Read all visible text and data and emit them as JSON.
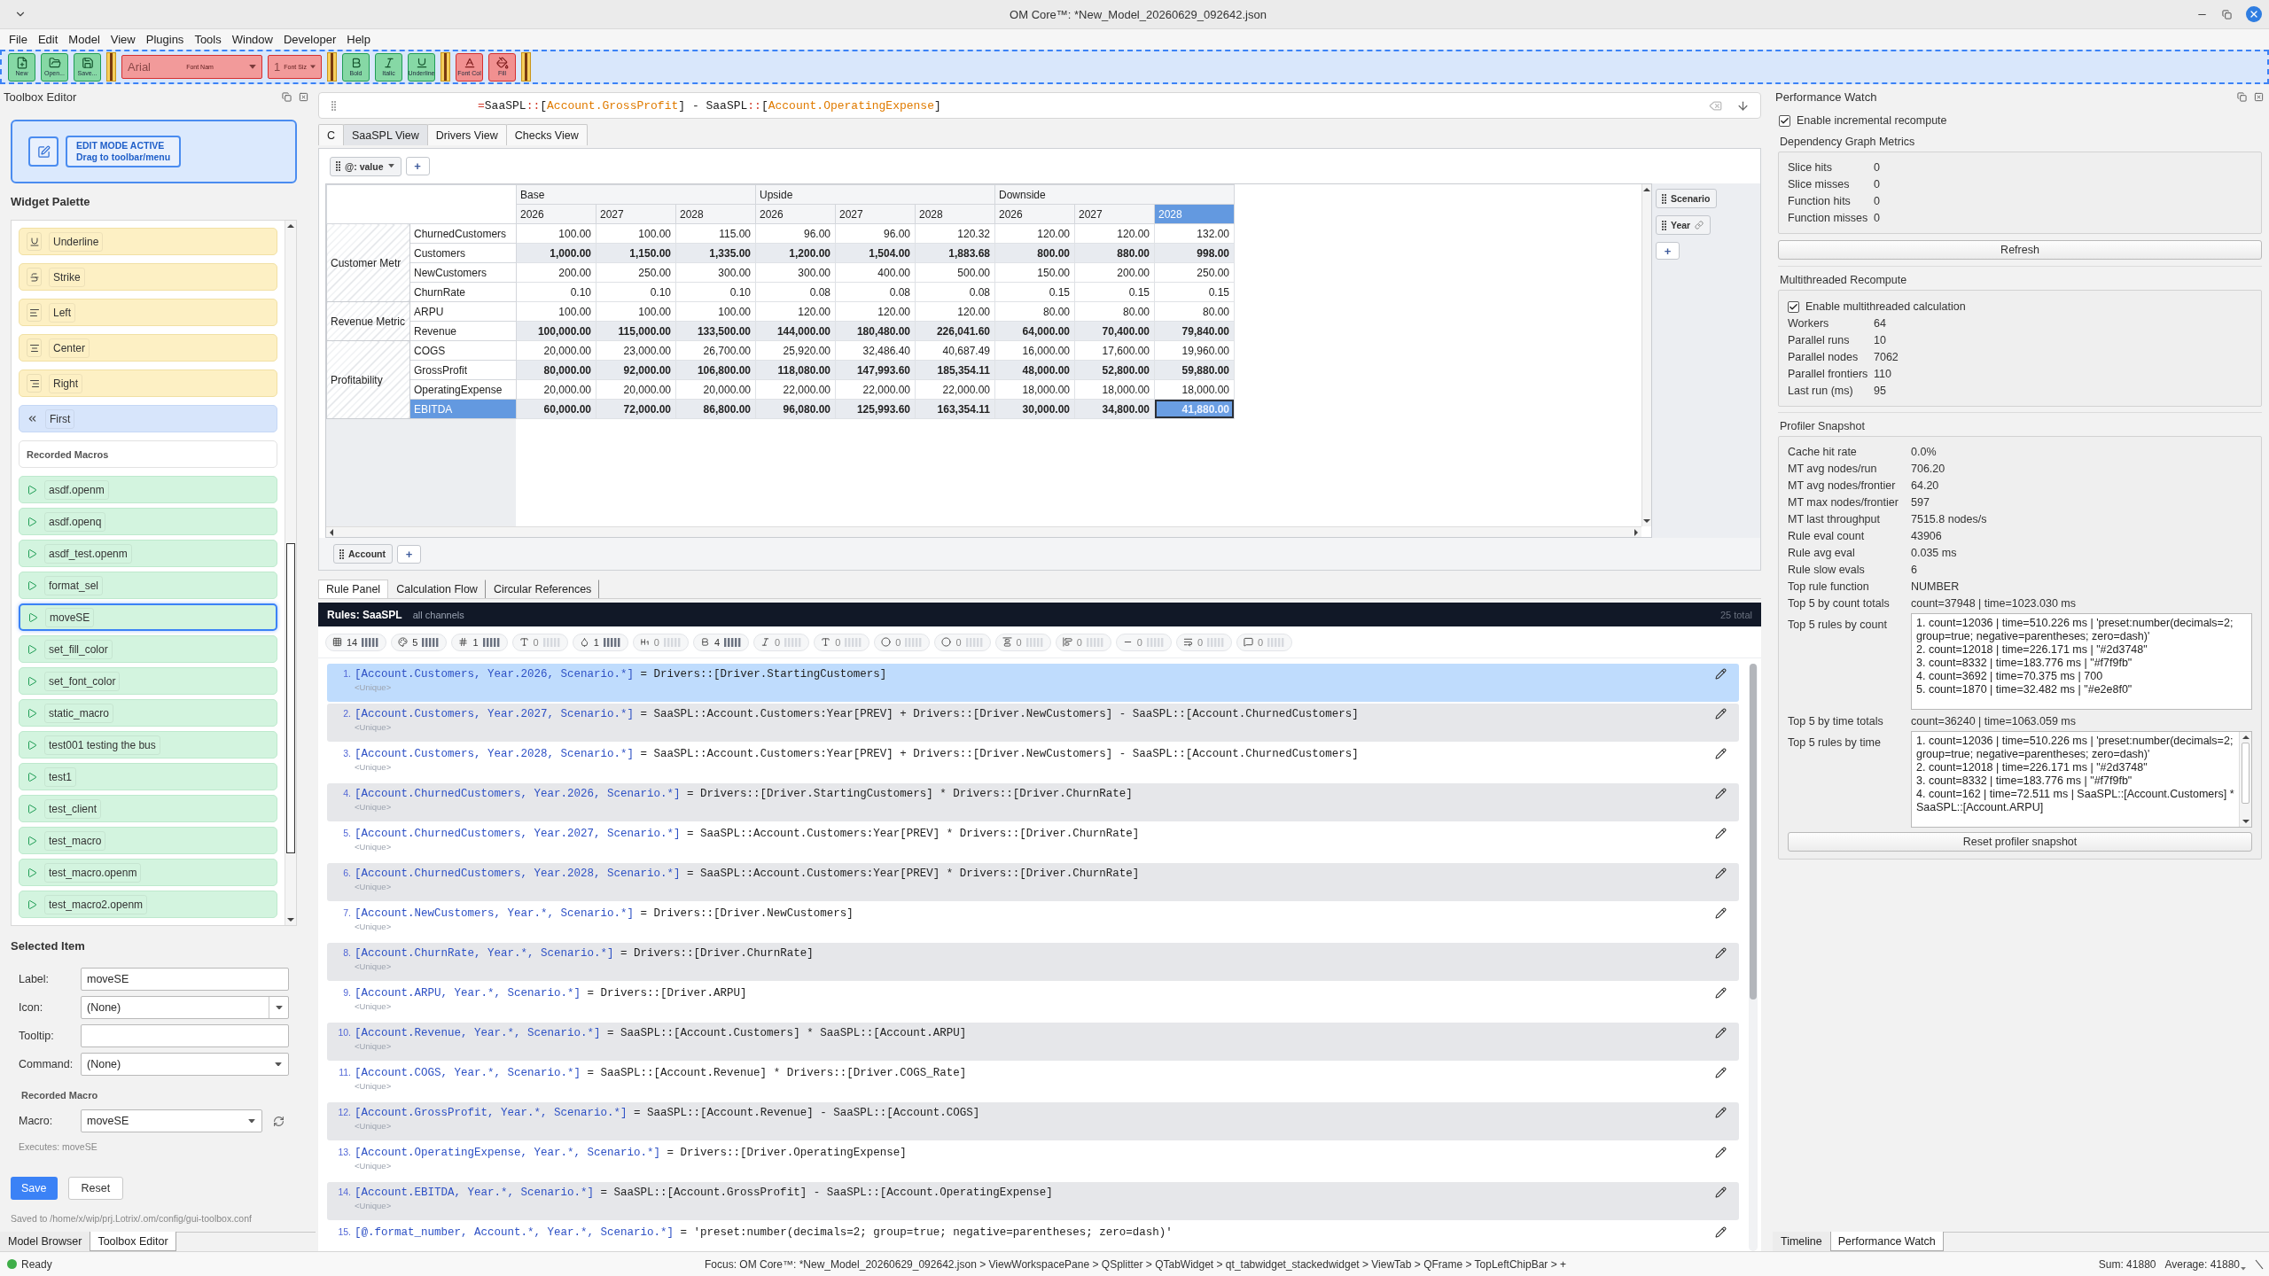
{
  "window": {
    "title": "OM Core™: *New_Model_20260629_092642.json"
  },
  "menu": [
    "File",
    "Edit",
    "Model",
    "View",
    "Plugins",
    "Tools",
    "Window",
    "Developer",
    "Help"
  ],
  "toolbar": [
    {
      "kind": "button",
      "label": "New"
    },
    {
      "kind": "button",
      "label": "Open..."
    },
    {
      "kind": "button",
      "label": "Save..."
    },
    {
      "kind": "separator"
    },
    {
      "kind": "combo",
      "value": "Arial",
      "label": "Font Nam"
    },
    {
      "kind": "combo",
      "value": "1",
      "label": "Font Siz"
    },
    {
      "kind": "separator"
    },
    {
      "kind": "button",
      "label": "Bold"
    },
    {
      "kind": "button",
      "label": "Italic"
    },
    {
      "kind": "button",
      "label": "Underline"
    },
    {
      "kind": "separator"
    },
    {
      "kind": "color",
      "label": "Font Col"
    },
    {
      "kind": "color",
      "label": "Fill"
    },
    {
      "kind": "separator"
    }
  ],
  "toolbox_editor": {
    "title": "Toolbox Editor",
    "edit_mode": {
      "title": "EDIT MODE ACTIVE",
      "hint": "Drag to toolbar/menu"
    },
    "palette_title": "Widget Palette",
    "palette": [
      {
        "kind": "format",
        "label": "Underline",
        "selected": false
      },
      {
        "kind": "format",
        "label": "Strike",
        "selected": false
      },
      {
        "kind": "format",
        "label": "Left",
        "selected": false
      },
      {
        "kind": "format",
        "label": "Center",
        "selected": false
      },
      {
        "kind": "format",
        "label": "Right",
        "selected": false
      },
      {
        "kind": "nav",
        "label": "First",
        "selected": false
      },
      {
        "kind": "header",
        "label": "Recorded Macros"
      },
      {
        "kind": "macro",
        "label": "asdf.openm",
        "selected": false
      },
      {
        "kind": "macro",
        "label": "asdf.openq",
        "selected": false
      },
      {
        "kind": "macro",
        "label": "asdf_test.openm",
        "selected": false
      },
      {
        "kind": "macro",
        "label": "format_sel",
        "selected": false
      },
      {
        "kind": "macro",
        "label": "moveSE",
        "selected": true
      },
      {
        "kind": "macro",
        "label": "set_fill_color",
        "selected": false
      },
      {
        "kind": "macro",
        "label": "set_font_color",
        "selected": false
      },
      {
        "kind": "macro",
        "label": "static_macro",
        "selected": false
      },
      {
        "kind": "macro",
        "label": "test001 testing the bus",
        "selected": false
      },
      {
        "kind": "macro",
        "label": "test1",
        "selected": false
      },
      {
        "kind": "macro",
        "label": "test_client",
        "selected": false
      },
      {
        "kind": "macro",
        "label": "test_macro",
        "selected": false
      },
      {
        "kind": "macro",
        "label": "test_macro.openm",
        "selected": false
      },
      {
        "kind": "macro",
        "label": "test_macro2.openm",
        "selected": false
      }
    ],
    "selected_item": {
      "title": "Selected Item",
      "fields": [
        {
          "kind": "text",
          "label": "Label:",
          "value": "moveSE"
        },
        {
          "kind": "editable-combo",
          "label": "Icon:",
          "value": "(None)"
        },
        {
          "kind": "text",
          "label": "Tooltip:"
        },
        {
          "kind": "combo",
          "label": "Command:",
          "value": "(None)"
        }
      ],
      "macro_title": "Recorded Macro",
      "macro_label": "Macro:",
      "macro_value": "moveSE",
      "macro_note": "Executes: moveSE",
      "save": "Save",
      "reset": "Reset",
      "saved_path": "Saved to /home/x/wip/prj.Lotrix/.om/config/gui-toolbox.conf"
    },
    "tabs": [
      {
        "label": "Model Browser",
        "selected": false
      },
      {
        "label": "Toolbox Editor",
        "selected": true
      }
    ]
  },
  "formula_bar": {
    "tokens": [
      {
        "kind": "op",
        "text": "="
      },
      {
        "kind": "plain",
        "text": "SaaSPL"
      },
      {
        "kind": "op",
        "text": "::"
      },
      {
        "kind": "plain",
        "text": "["
      },
      {
        "kind": "member",
        "text": "Account.GrossProfit"
      },
      {
        "kind": "plain",
        "text": "] - SaaSPL"
      },
      {
        "kind": "op",
        "text": "::"
      },
      {
        "kind": "plain",
        "text": "["
      },
      {
        "kind": "member",
        "text": "Account.OperatingExpense"
      },
      {
        "kind": "plain",
        "text": "]"
      }
    ]
  },
  "view_tabs": [
    {
      "label": "C",
      "selected": false
    },
    {
      "label": "SaaSPL View",
      "selected": true
    },
    {
      "label": "Drivers View",
      "selected": false
    },
    {
      "label": "Checks View",
      "selected": false
    }
  ],
  "pivot": {
    "top_chips": [
      {
        "label": "@: value",
        "dropdown": true
      }
    ],
    "top_add": "+",
    "column_chips": [
      {
        "label": "Scenario",
        "linked": false
      },
      {
        "label": "Year",
        "linked": true
      }
    ],
    "column_add": "+",
    "row_chips": [
      {
        "label": "Account"
      }
    ],
    "row_add": "+",
    "column_groups": [
      {
        "label": "Base",
        "columns": [
          {
            "label": "2026",
            "selected": false
          },
          {
            "label": "2027",
            "selected": false
          },
          {
            "label": "2028",
            "selected": false
          }
        ]
      },
      {
        "label": "Upside",
        "columns": [
          {
            "label": "2026",
            "selected": false
          },
          {
            "label": "2027",
            "selected": false
          },
          {
            "label": "2028",
            "selected": false
          }
        ]
      },
      {
        "label": "Downside",
        "columns": [
          {
            "label": "2026",
            "selected": false
          },
          {
            "label": "2027",
            "selected": false
          },
          {
            "label": "2028",
            "selected": true
          }
        ]
      }
    ],
    "row_groups": [
      {
        "label": "Customer Metr",
        "rows": [
          {
            "label": "ChurnedCustomers",
            "bold": false,
            "selected": false,
            "cells": [
              "100.00",
              "100.00",
              "115.00",
              "96.00",
              "96.00",
              "120.32",
              "120.00",
              "120.00",
              "132.00"
            ]
          },
          {
            "label": "Customers",
            "bold": true,
            "selected": false,
            "cells": [
              "1,000.00",
              "1,150.00",
              "1,335.00",
              "1,200.00",
              "1,504.00",
              "1,883.68",
              "800.00",
              "880.00",
              "998.00"
            ]
          },
          {
            "label": "NewCustomers",
            "bold": false,
            "selected": false,
            "cells": [
              "200.00",
              "250.00",
              "300.00",
              "300.00",
              "400.00",
              "500.00",
              "150.00",
              "200.00",
              "250.00"
            ]
          },
          {
            "label": "ChurnRate",
            "bold": false,
            "selected": false,
            "cells": [
              "0.10",
              "0.10",
              "0.10",
              "0.08",
              "0.08",
              "0.08",
              "0.15",
              "0.15",
              "0.15"
            ]
          }
        ]
      },
      {
        "label": "Revenue Metric",
        "rows": [
          {
            "label": "ARPU",
            "bold": false,
            "selected": false,
            "cells": [
              "100.00",
              "100.00",
              "100.00",
              "120.00",
              "120.00",
              "120.00",
              "80.00",
              "80.00",
              "80.00"
            ]
          },
          {
            "label": "Revenue",
            "bold": true,
            "selected": false,
            "cells": [
              "100,000.00",
              "115,000.00",
              "133,500.00",
              "144,000.00",
              "180,480.00",
              "226,041.60",
              "64,000.00",
              "70,400.00",
              "79,840.00"
            ]
          }
        ]
      },
      {
        "label": "Profitability",
        "rows": [
          {
            "label": "COGS",
            "bold": false,
            "selected": false,
            "cells": [
              "20,000.00",
              "23,000.00",
              "26,700.00",
              "25,920.00",
              "32,486.40",
              "40,687.49",
              "16,000.00",
              "17,600.00",
              "19,960.00"
            ]
          },
          {
            "label": "GrossProfit",
            "bold": true,
            "selected": false,
            "cells": [
              "80,000.00",
              "92,000.00",
              "106,800.00",
              "118,080.00",
              "147,993.60",
              "185,354.11",
              "48,000.00",
              "52,800.00",
              "59,880.00"
            ]
          },
          {
            "label": "OperatingExpense",
            "bold": false,
            "selected": false,
            "cells": [
              "20,000.00",
              "20,000.00",
              "20,000.00",
              "22,000.00",
              "22,000.00",
              "22,000.00",
              "18,000.00",
              "18,000.00",
              "18,000.00"
            ]
          },
          {
            "label": "EBITDA",
            "bold": true,
            "selected": true,
            "cells": [
              "60,000.00",
              "72,000.00",
              "86,800.00",
              "96,080.00",
              "125,993.60",
              "163,354.11",
              "30,000.00",
              "34,800.00",
              "41,880.00"
            ]
          }
        ]
      }
    ]
  },
  "rule_tabs": [
    {
      "label": "Rule Panel",
      "selected": true
    },
    {
      "label": "Calculation Flow",
      "selected": false
    },
    {
      "label": "Circular References",
      "selected": false
    }
  ],
  "rules": {
    "title": "Rules: SaaSPL",
    "scope": "all channels",
    "total": "25 total",
    "stats": [
      {
        "count": "14",
        "active": true
      },
      {
        "count": "5",
        "active": true
      },
      {
        "count": "1",
        "active": true
      },
      {
        "count": "0",
        "active": false
      },
      {
        "count": "1",
        "active": true
      },
      {
        "count": "0",
        "active": false
      },
      {
        "count": "4",
        "active": true
      },
      {
        "count": "0",
        "active": false
      },
      {
        "count": "0",
        "active": false
      },
      {
        "count": "0",
        "active": false
      },
      {
        "count": "0",
        "active": false
      },
      {
        "count": "0",
        "active": false
      },
      {
        "count": "0",
        "active": false
      },
      {
        "count": "0",
        "active": false
      },
      {
        "count": "0",
        "active": false
      },
      {
        "count": "0",
        "active": false
      }
    ],
    "items": [
      {
        "number": "1.",
        "target": "[Account.Customers, Year.2026, Scenario.*]",
        "operator": "=",
        "formula": "Drivers::[Driver.StartingCustomers]",
        "tag": "<Unique>",
        "selected": true
      },
      {
        "number": "2.",
        "target": "[Account.Customers, Year.2027, Scenario.*]",
        "operator": "=",
        "formula": "SaaSPL::Account.Customers:Year[PREV] + Drivers::[Driver.NewCustomers] - SaaSPL::[Account.ChurnedCustomers]",
        "tag": "<Unique>",
        "selected": false
      },
      {
        "number": "3.",
        "target": "[Account.Customers, Year.2028, Scenario.*]",
        "operator": "=",
        "formula": "SaaSPL::Account.Customers:Year[PREV] + Drivers::[Driver.NewCustomers] - SaaSPL::[Account.ChurnedCustomers]",
        "tag": "<Unique>",
        "selected": false
      },
      {
        "number": "4.",
        "target": "[Account.ChurnedCustomers, Year.2026, Scenario.*]",
        "operator": "=",
        "formula": "Drivers::[Driver.StartingCustomers] * Drivers::[Driver.ChurnRate]",
        "tag": "<Unique>",
        "selected": false
      },
      {
        "number": "5.",
        "target": "[Account.ChurnedCustomers, Year.2027, Scenario.*]",
        "operator": "=",
        "formula": "SaaSPL::Account.Customers:Year[PREV] * Drivers::[Driver.ChurnRate]",
        "tag": "<Unique>",
        "selected": false
      },
      {
        "number": "6.",
        "target": "[Account.ChurnedCustomers, Year.2028, Scenario.*]",
        "operator": "=",
        "formula": "SaaSPL::Account.Customers:Year[PREV] * Drivers::[Driver.ChurnRate]",
        "tag": "<Unique>",
        "selected": false
      },
      {
        "number": "7.",
        "target": "[Account.NewCustomers, Year.*, Scenario.*]",
        "operator": "=",
        "formula": "Drivers::[Driver.NewCustomers]",
        "tag": "<Unique>",
        "selected": false
      },
      {
        "number": "8.",
        "target": "[Account.ChurnRate, Year.*, Scenario.*]",
        "operator": "=",
        "formula": "Drivers::[Driver.ChurnRate]",
        "tag": "<Unique>",
        "selected": false
      },
      {
        "number": "9.",
        "target": "[Account.ARPU, Year.*, Scenario.*]",
        "operator": "=",
        "formula": "Drivers::[Driver.ARPU]",
        "tag": "<Unique>",
        "selected": false
      },
      {
        "number": "10.",
        "target": "[Account.Revenue, Year.*, Scenario.*]",
        "operator": "=",
        "formula": "SaaSPL::[Account.Customers] * SaaSPL::[Account.ARPU]",
        "tag": "<Unique>",
        "selected": false
      },
      {
        "number": "11.",
        "target": "[Account.COGS, Year.*, Scenario.*]",
        "operator": "=",
        "formula": "SaaSPL::[Account.Revenue] * Drivers::[Driver.COGS_Rate]",
        "tag": "<Unique>",
        "selected": false
      },
      {
        "number": "12.",
        "target": "[Account.GrossProfit, Year.*, Scenario.*]",
        "operator": "=",
        "formula": "SaaSPL::[Account.Revenue] - SaaSPL::[Account.COGS]",
        "tag": "<Unique>",
        "selected": false
      },
      {
        "number": "13.",
        "target": "[Account.OperatingExpense, Year.*, Scenario.*]",
        "operator": "=",
        "formula": "Drivers::[Driver.OperatingExpense]",
        "tag": "<Unique>",
        "selected": false
      },
      {
        "number": "14.",
        "target": "[Account.EBITDA, Year.*, Scenario.*]",
        "operator": "=",
        "formula": "SaaSPL::[Account.GrossProfit] - SaaSPL::[Account.OperatingExpense]",
        "tag": "<Unique>",
        "selected": false
      },
      {
        "number": "15.",
        "target": "[@.format_number, Account.*, Year.*, Scenario.*]",
        "operator": "=",
        "formula": "'preset:number(decimals=2; group=true; negative=parentheses; zero=dash)'",
        "selected": false
      }
    ]
  },
  "performance_watch": {
    "title": "Performance Watch",
    "incremental": {
      "label": "Enable incremental recompute",
      "checked": true
    },
    "graph_title": "Dependency Graph Metrics",
    "graph_metrics": [
      {
        "label": "Slice hits",
        "value": "0"
      },
      {
        "label": "Slice misses",
        "value": "0"
      },
      {
        "label": "Function hits",
        "value": "0"
      },
      {
        "label": "Function misses",
        "value": "0"
      }
    ],
    "refresh": "Refresh",
    "mt_title": "Multithreaded Recompute",
    "mt_toggle": {
      "label": "Enable multithreaded calculation",
      "checked": true
    },
    "mt_metrics": [
      {
        "label": "Workers",
        "value": "64"
      },
      {
        "label": "Parallel runs",
        "value": "10"
      },
      {
        "label": "Parallel nodes",
        "value": "7062"
      },
      {
        "label": "Parallel frontiers",
        "value": "110"
      },
      {
        "label": "Last run (ms)",
        "value": "95"
      }
    ],
    "profiler_title": "Profiler Snapshot",
    "profiler_metrics": [
      {
        "kind": "value",
        "label": "Cache hit rate",
        "value": "0.0%"
      },
      {
        "kind": "value",
        "label": "MT avg nodes/run",
        "value": "706.20"
      },
      {
        "kind": "value",
        "label": "MT avg nodes/frontier",
        "value": "64.20"
      },
      {
        "kind": "value",
        "label": "MT max nodes/frontier",
        "value": "597"
      },
      {
        "kind": "value",
        "label": "MT last throughput",
        "value": "7515.8 nodes/s"
      },
      {
        "kind": "value",
        "label": "Rule eval count",
        "value": "43906"
      },
      {
        "kind": "value",
        "label": "Rule avg eval",
        "value": "0.035 ms"
      },
      {
        "kind": "value",
        "label": "Rule slow evals",
        "value": "6"
      },
      {
        "kind": "value",
        "label": "Top rule function",
        "value": "NUMBER"
      },
      {
        "kind": "value",
        "label": "Top 5 by count totals",
        "value": "count=37948 | time=1023.030 ms"
      },
      {
        "kind": "list",
        "label": "Top 5 rules by count",
        "lines": [
          "1. count=12036 | time=510.226 ms | 'preset:number(decimals=2; group=true; negative=parentheses; zero=dash)'",
          "2. count=12018 | time=226.171 ms | \"#2d3748\"",
          "3. count=8332 | time=183.776 ms | \"#f7f9fb\"",
          "4. count=3692 | time=70.375 ms | 700",
          "5. count=1870 | time=32.482 ms | \"#e2e8f0\""
        ]
      },
      {
        "kind": "value",
        "label": "Top 5 by time totals",
        "value": "count=36240 | time=1063.059 ms"
      },
      {
        "kind": "scroll-list",
        "label": "Top 5 rules by time",
        "lines": [
          "1. count=12036 | time=510.226 ms | 'preset:number(decimals=2; group=true; negative=parentheses; zero=dash)'",
          "2. count=12018 | time=226.171 ms | \"#2d3748\"",
          "3. count=8332 | time=183.776 ms | \"#f7f9fb\"",
          "4. count=162 | time=72.511 ms | SaaSPL::[Account.Customers] * SaaSPL::[Account.ARPU]"
        ]
      }
    ],
    "reset": "Reset profiler snapshot"
  },
  "right_tabs": [
    {
      "label": "Timeline",
      "selected": false
    },
    {
      "label": "Performance Watch",
      "selected": true
    }
  ],
  "status_bar": {
    "status": "Ready",
    "focus": "Focus: OM Core™: *New_Model_20260629_092642.json > ViewWorkspacePane > QSplitter > QTabWidget > qt_tabwidget_stackedwidget > ViewTab > QFrame > TopLeftChipBar > +",
    "sum": "Sum: 41880",
    "average": "Average: 41880"
  }
}
